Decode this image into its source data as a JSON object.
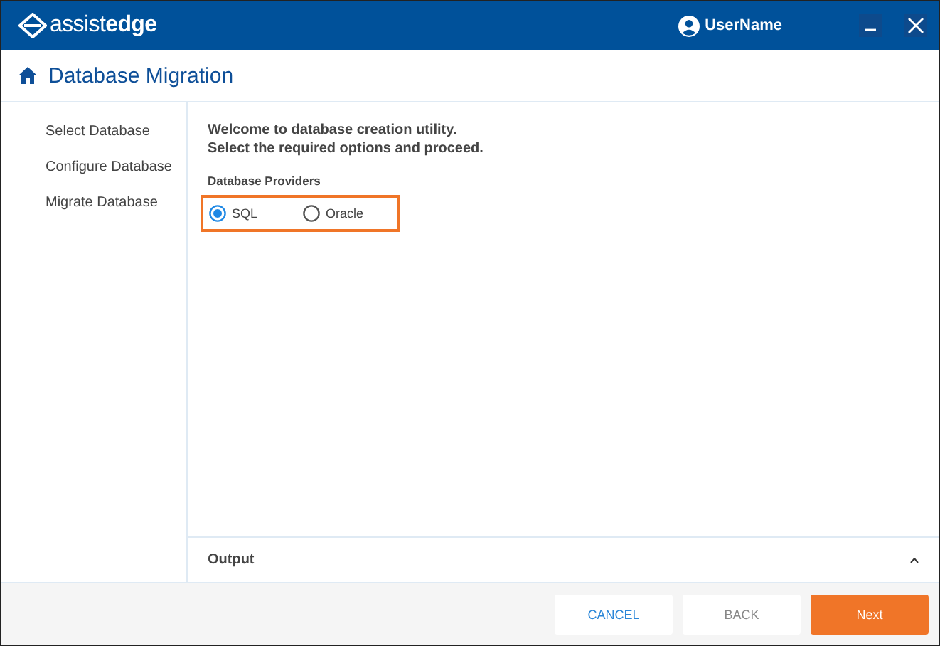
{
  "header": {
    "logo": "assist**edge**",
    "user": "UserName"
  },
  "page": {
    "title": "Database Migration"
  },
  "sidebar": {
    "items": [
      {
        "label": "Select Database"
      },
      {
        "label": "Configure Database"
      },
      {
        "label": "Migrate Database"
      }
    ]
  },
  "content": {
    "intro": [
      "Welcome to database creation utility.",
      "Select the required options and proceed."
    ],
    "providers": {
      "label": "Database Providers",
      "options": [
        {
          "label": "SQL",
          "selected": true
        },
        {
          "label": "Oracle",
          "selected": false
        }
      ]
    }
  },
  "output": {
    "label": "Output",
    "expanded": false
  },
  "buttons": [
    {
      "label": "CANCEL",
      "kind": "secondary",
      "disabled": false
    },
    {
      "label": "BACK",
      "kind": "secondary",
      "disabled": true
    },
    {
      "label": "Next",
      "kind": "primary",
      "disabled": false
    }
  ]
}
